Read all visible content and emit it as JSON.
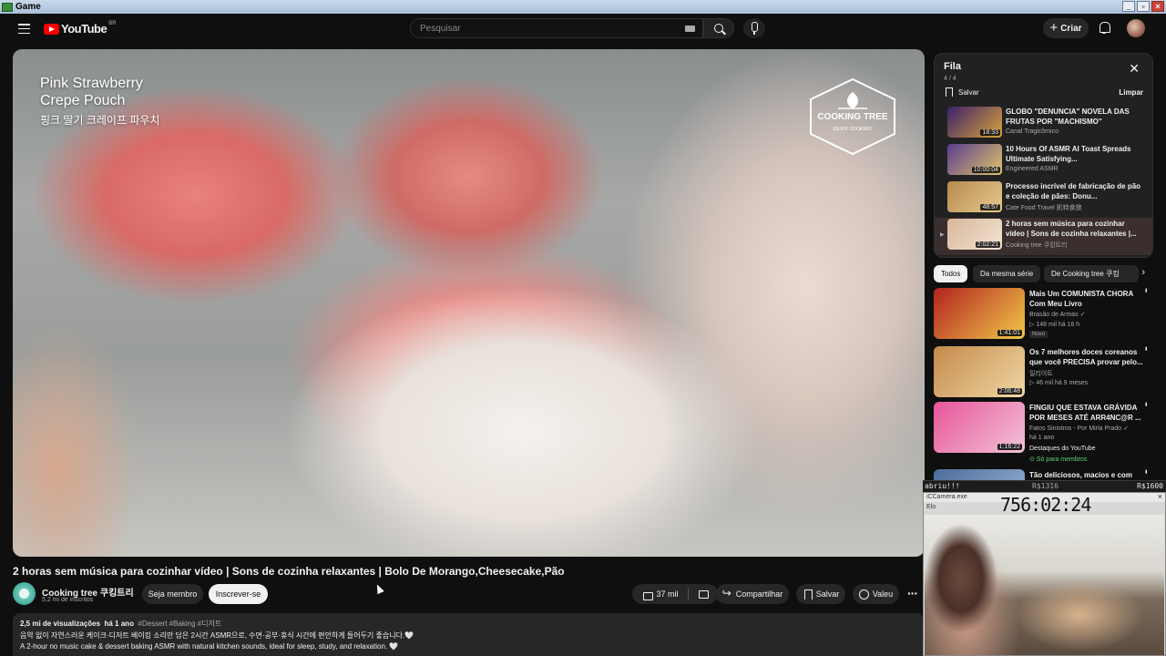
{
  "window": {
    "title": "Game"
  },
  "header": {
    "logo_text": "YouTube",
    "country_code": "BR",
    "search_placeholder": "Pesquisar",
    "create_label": "Criar"
  },
  "player": {
    "overlay_title_line1": "Pink Strawberry",
    "overlay_title_line2": "Crepe Pouch",
    "overlay_title_korean": "핑크 딸기 크레이프 파우치",
    "brand_logo_name": "COOKING TREE",
    "brand_logo_sub": "ENJOY COOKING!"
  },
  "video": {
    "title": "2 horas sem música para cozinhar vídeo | Sons de cozinha relaxantes | Bolo De Morango,Cheesecake,Pão",
    "channel_name": "Cooking tree 쿠킹트리",
    "subscribers": "5,2 mi de inscritos",
    "join_label": "Seja membro",
    "subscribe_label": "Inscrever-se",
    "likes": "37 mil",
    "share_label": "Compartilhar",
    "save_label": "Salvar",
    "thanks_label": "Valeu",
    "description": {
      "views": "2,5 mi de visualizações",
      "age": "há 1 ano",
      "tags": "#Dessert #Baking #디저트",
      "line1": "음악 없이 자연스러운 케이크·디저트 베이킹 소리만 담은 2시간 ASMR으로, 수면·공부·휴식 시간에 편안하게 들어두기 좋습니다.🤍",
      "line2": "A 2-hour no music cake & dessert baking ASMR with natural kitchen sounds, ideal for sleep, study, and relaxation. 🤍"
    }
  },
  "queue": {
    "title": "Fila",
    "count": "4 / 4",
    "save_label": "Salvar",
    "clear_label": "Limpar",
    "items": [
      {
        "title": "GLOBO \"DENUNCIA\" NOVELA DAS FRUTAS POR \"MACHISMO\"",
        "channel": "Canal Tragicômico",
        "duration": "18:33",
        "color1": "#3b1f6b",
        "color2": "#d9a33a"
      },
      {
        "title": "10 Hours Of ASMR AI Toast Spreads Ultimate Satisfying...",
        "channel": "Engineered ASMR",
        "duration": "10:00:04",
        "color1": "#5a3c8f",
        "color2": "#e0c46a"
      },
      {
        "title": "Processo incrível de fabricação de pão e coleção de pães: Donu...",
        "channel": "Cate Food Travel 凯特食旅",
        "duration": "48:57",
        "color1": "#b68a4e",
        "color2": "#e8c98e"
      },
      {
        "title": "2 horas sem música para cozinhar vídeo | Sons de cozinha relaxantes |...",
        "channel": "Cooking tree 쿠킹트리",
        "duration": "2:02:21",
        "color1": "#d9b79a",
        "color2": "#f1e3d3"
      }
    ]
  },
  "chips": [
    {
      "label": "Todos",
      "active": true
    },
    {
      "label": "Da mesma série",
      "active": false
    },
    {
      "label": "De Cooking tree 쿠킹",
      "active": false
    }
  ],
  "recommendations": [
    {
      "title": "Mais Um COMUNISTA CHORA Com Meu Livro",
      "channel": "Brasão de Armas ✓",
      "meta": "▷ 148 mil há 16 h",
      "badge": "Novo",
      "duration": "1:41:01",
      "color1": "#b3221f",
      "color2": "#f0c84a"
    },
    {
      "title": "Os 7 melhores doces coreanos que você PRECISA provar pelo...",
      "channel": "릴리이트",
      "meta": "▷ 46 mil há 9 meses",
      "badge": "",
      "duration": "2:06:48",
      "color1": "#c48a4a",
      "color2": "#f0d7a6"
    },
    {
      "title": "FINGIU QUE ESTAVA GRÁVIDA POR MESES ATÉ ARR4NC@R ...",
      "channel": "Fatos Sinistros - Por Mirla Prado ✓",
      "meta": "há 1 ano",
      "badge": "Destaques do YouTube",
      "extra": "⊙ Só para membros",
      "duration": "1:16:22",
      "color1": "#e8559a",
      "color2": "#f2c3d7"
    },
    {
      "title": "Tão deliciosos, macios e com",
      "channel": "",
      "meta": "",
      "badge": "",
      "duration": "",
      "color1": "#4d6d9a",
      "color2": "#9bb5d6"
    }
  ],
  "overlay": {
    "left_label": "abriu!!!",
    "goal_left": "R$1316",
    "goal_right": "R$1600",
    "cam_window_name": "iCCamera.exe",
    "cam_menu": "Elo",
    "timer": "756:02:24"
  }
}
